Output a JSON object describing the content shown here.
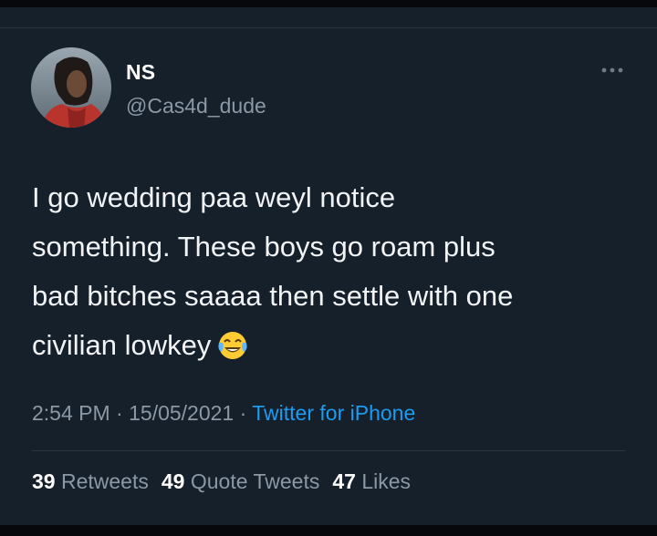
{
  "user": {
    "display_name": "NS",
    "handle": "@Cas4d_dude"
  },
  "tweet": {
    "text": "I go wedding paa weyl notice\nsomething. These boys go roam plus\nbad bitches saaaa then settle with one\ncivilian lowkey",
    "emoji": "face-with-tears-of-joy-icon"
  },
  "meta": {
    "time": "2:54 PM",
    "separator": "·",
    "date": "15/05/2021",
    "source": "Twitter for iPhone"
  },
  "stats": {
    "retweets_count": "39",
    "retweets_label": "Retweets",
    "quotes_count": "49",
    "quotes_label": "Quote Tweets",
    "likes_count": "47",
    "likes_label": "Likes"
  },
  "colors": {
    "background": "#15202b",
    "text": "#f1f3f5",
    "secondary": "#8b98a5",
    "link": "#1d9bf0"
  }
}
